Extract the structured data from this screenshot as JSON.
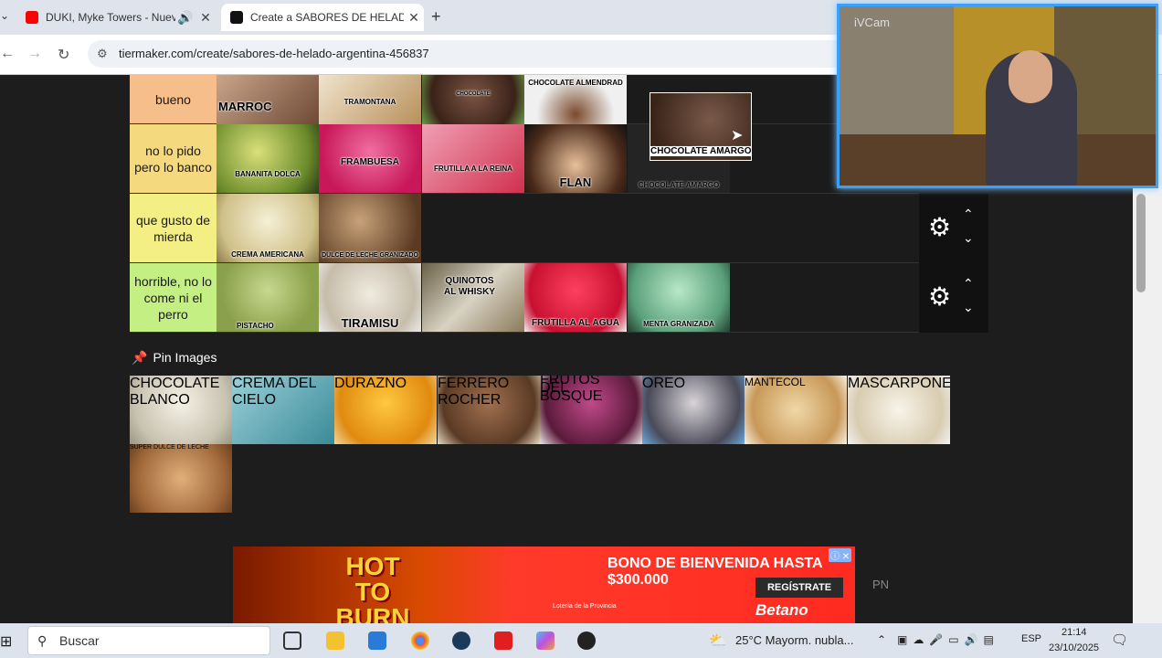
{
  "browser": {
    "tabs": [
      {
        "title": "DUKI, Myke Towers - Nueva",
        "favicon_color": "#ff0000",
        "state": "inactive"
      },
      {
        "title": "Create a SABORES DE HELADO",
        "favicon_color": "#000000",
        "state": "active"
      }
    ],
    "new_tab_label": "+",
    "close_label": "✕",
    "url": "tiermaker.com/create/sabores-de-helado-argentina-456837"
  },
  "tiers": [
    {
      "label": "bueno",
      "color": "#f6be8a",
      "items": [
        "MARROC",
        "TRAMONTANA",
        "CHOCOLATE",
        "CHOCOLATE ALMENDRAD"
      ]
    },
    {
      "label": "no lo pido pero lo banco",
      "color": "#f5d97e",
      "items": [
        "BANANITA DOLCA",
        "FRAMBUESA",
        "FRUTILLA A LA REINA",
        "FLAN",
        "CHOCOLATE AMARGO"
      ]
    },
    {
      "label": "que gusto de mierda",
      "color": "#f3ef84",
      "items": [
        "CREMA AMERICANA",
        "DULCE DE LECHE GRANIZADO"
      ]
    },
    {
      "label": "horrible, no lo come ni el perro",
      "color": "#c4f083",
      "items": [
        "PISTACHO",
        "TIRAMISU",
        "QUINOTOS AL WHISKY",
        "FRUTILLA AL AGUA",
        "MENTA GRANIZADA"
      ]
    }
  ],
  "dragging_item": "CHOCOLATE AMARGO",
  "pin_images_label": "Pin Images",
  "pool": [
    "CHOCOLATE BLANCO",
    "CREMA DEL CIELO",
    "DURAZNO",
    "FERRERO ROCHER",
    "FRUTOS DEL BOSQUE",
    "OREO",
    "MANTECOL",
    "MASCARPONE",
    "SUPER DULCE DE LECHE"
  ],
  "ad": {
    "hot_to_burn": "HOT TO BURN",
    "bono": "BONO DE BIENVENIDA HASTA $300.000",
    "register": "REGÍSTRATE",
    "brand": "Betano",
    "lottery": "Lotería de la Provincia"
  },
  "pn_label": "PN",
  "webcam_label": "iVCam",
  "taskbar": {
    "search_placeholder": "Buscar",
    "weather": "25°C  Mayorm. nubla...",
    "lang": "ESP",
    "time": "21:14",
    "date": "23/10/2025"
  }
}
